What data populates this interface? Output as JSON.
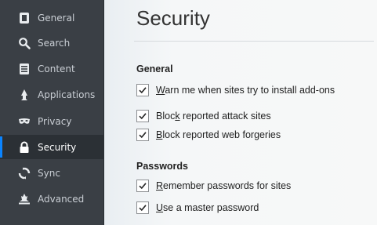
{
  "sidebar": {
    "items": [
      {
        "label": "General",
        "icon": "general-icon"
      },
      {
        "label": "Search",
        "icon": "search-icon"
      },
      {
        "label": "Content",
        "icon": "content-icon"
      },
      {
        "label": "Applications",
        "icon": "applications-icon"
      },
      {
        "label": "Privacy",
        "icon": "privacy-mask-icon"
      },
      {
        "label": "Security",
        "icon": "lock-icon",
        "selected": true
      },
      {
        "label": "Sync",
        "icon": "sync-icon"
      },
      {
        "label": "Advanced",
        "icon": "advanced-icon"
      }
    ]
  },
  "main": {
    "title": "Security",
    "sections": {
      "general": {
        "heading": "General",
        "warn": {
          "pre": "",
          "ul": "W",
          "post": "arn me when sites try to install add-ons",
          "checked": true
        },
        "attack": {
          "pre": "Bloc",
          "ul": "k",
          "post": " reported attack sites",
          "checked": true
        },
        "forgeries": {
          "pre": "",
          "ul": "B",
          "post": "lock reported web forgeries",
          "checked": true
        }
      },
      "passwords": {
        "heading": "Passwords",
        "remember": {
          "pre": "",
          "ul": "R",
          "post": "emember passwords for sites",
          "checked": true
        },
        "master": {
          "pre": "",
          "ul": "U",
          "post": "se a master password",
          "checked": true
        }
      }
    }
  },
  "colors": {
    "sidebar_bg": "#3a3f45",
    "selected_bg": "#2b3035",
    "accent": "#0a84ff"
  }
}
